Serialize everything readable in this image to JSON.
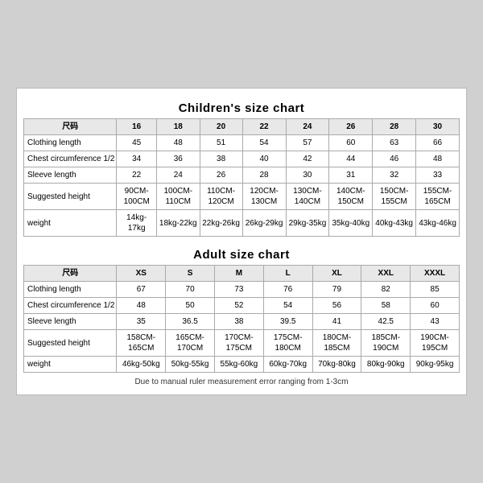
{
  "children_chart": {
    "title": "Children's size chart",
    "columns": [
      "尺码",
      "16",
      "18",
      "20",
      "22",
      "24",
      "26",
      "28",
      "30"
    ],
    "rows": [
      {
        "label": "Clothing length",
        "values": [
          "45",
          "48",
          "51",
          "54",
          "57",
          "60",
          "63",
          "66"
        ]
      },
      {
        "label": "Chest circumference 1/2",
        "values": [
          "34",
          "36",
          "38",
          "40",
          "42",
          "44",
          "46",
          "48"
        ]
      },
      {
        "label": "Sleeve length",
        "values": [
          "22",
          "24",
          "26",
          "28",
          "30",
          "31",
          "32",
          "33"
        ]
      },
      {
        "label": "Suggested height",
        "values": [
          "90CM-100CM",
          "100CM-110CM",
          "110CM-120CM",
          "120CM-130CM",
          "130CM-140CM",
          "140CM-150CM",
          "150CM-155CM",
          "155CM-165CM"
        ]
      },
      {
        "label": "weight",
        "values": [
          "14kg-17kg",
          "18kg-22kg",
          "22kg-26kg",
          "26kg-29kg",
          "29kg-35kg",
          "35kg-40kg",
          "40kg-43kg",
          "43kg-46kg"
        ]
      }
    ]
  },
  "adult_chart": {
    "title": "Adult size chart",
    "columns": [
      "尺码",
      "XS",
      "S",
      "M",
      "L",
      "XL",
      "XXL",
      "XXXL"
    ],
    "rows": [
      {
        "label": "Clothing length",
        "values": [
          "67",
          "70",
          "73",
          "76",
          "79",
          "82",
          "85"
        ]
      },
      {
        "label": "Chest circumference 1/2",
        "values": [
          "48",
          "50",
          "52",
          "54",
          "56",
          "58",
          "60"
        ]
      },
      {
        "label": "Sleeve length",
        "values": [
          "35",
          "36.5",
          "38",
          "39.5",
          "41",
          "42.5",
          "43"
        ]
      },
      {
        "label": "Suggested height",
        "values": [
          "158CM-165CM",
          "165CM-170CM",
          "170CM-175CM",
          "175CM-180CM",
          "180CM-185CM",
          "185CM-190CM",
          "190CM-195CM"
        ]
      },
      {
        "label": "weight",
        "values": [
          "46kg-50kg",
          "50kg-55kg",
          "55kg-60kg",
          "60kg-70kg",
          "70kg-80kg",
          "80kg-90kg",
          "90kg-95kg"
        ]
      }
    ]
  },
  "footer": "Due to manual ruler measurement error ranging from 1-3cm"
}
